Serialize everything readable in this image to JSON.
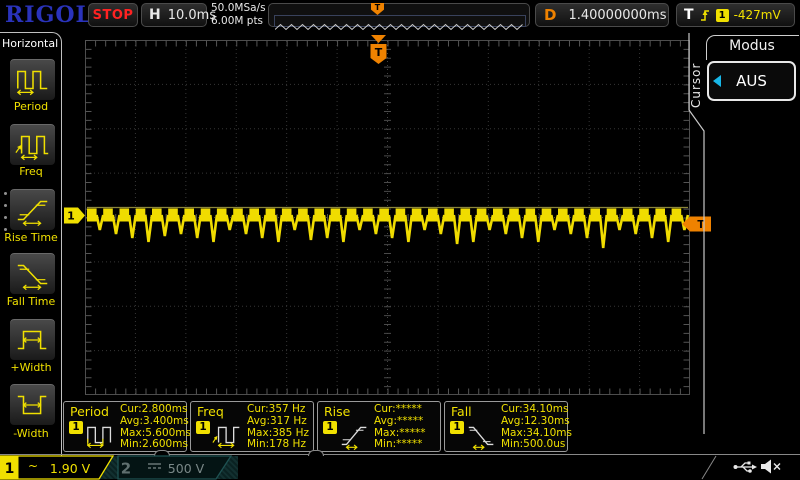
{
  "topbar": {
    "logo": "RIGOL",
    "run_state": "STOP",
    "h_label": "H",
    "timebase": "10.0ms",
    "sample_rate": "50.0MSa/s",
    "memory_depth": "6.00M pts",
    "delay_label": "D",
    "delay_value": "1.40000000ms",
    "trigger_label": "T",
    "trigger_source": "1",
    "trigger_level": "-427mV"
  },
  "left_menu": {
    "title": "Horizontal",
    "items": [
      {
        "label": "Period"
      },
      {
        "label": "Freq"
      },
      {
        "label": "Rise Time"
      },
      {
        "label": "Fall Time"
      },
      {
        "label": "+Width"
      },
      {
        "label": "-Width"
      }
    ]
  },
  "right_menu": {
    "tab": "Cursor",
    "title": "Modus",
    "value": "AUS"
  },
  "display": {
    "channel_badge": "1",
    "trigger_marker": "T"
  },
  "measurements": [
    {
      "name": "Period",
      "channel": "1",
      "rows": [
        "Cur:2.800ms",
        "Avg:3.400ms",
        "Max:5.600ms",
        "Min:2.600ms"
      ]
    },
    {
      "name": "Freq",
      "channel": "1",
      "rows": [
        "Cur:357 Hz",
        "Avg:317 Hz",
        "Max:385 Hz",
        "Min:178 Hz"
      ]
    },
    {
      "name": "Rise",
      "channel": "1",
      "rows": [
        "Cur:*****",
        "Avg:*****",
        "Max:*****",
        "Min:*****"
      ]
    },
    {
      "name": "Fall",
      "channel": "1",
      "rows": [
        "Cur:34.10ms",
        "Avg:12.30ms",
        "Max:34.10ms",
        "Min:500.0us"
      ]
    }
  ],
  "channels": [
    {
      "id": "1",
      "coupling": "~",
      "scale": "1.90 V"
    },
    {
      "id": "2",
      "coupling": "DC",
      "scale": "500 V"
    }
  ],
  "status_icons": [
    "usb-icon",
    "speaker-muted-icon"
  ],
  "colors": {
    "accent_yellow": "#f0e000",
    "accent_orange": "#ef8200",
    "logo_blue": "#2a33bb",
    "stop_red": "#ff2222",
    "cursor_blue": "#18b7e8",
    "channel2_teal": "#1e5252"
  }
}
